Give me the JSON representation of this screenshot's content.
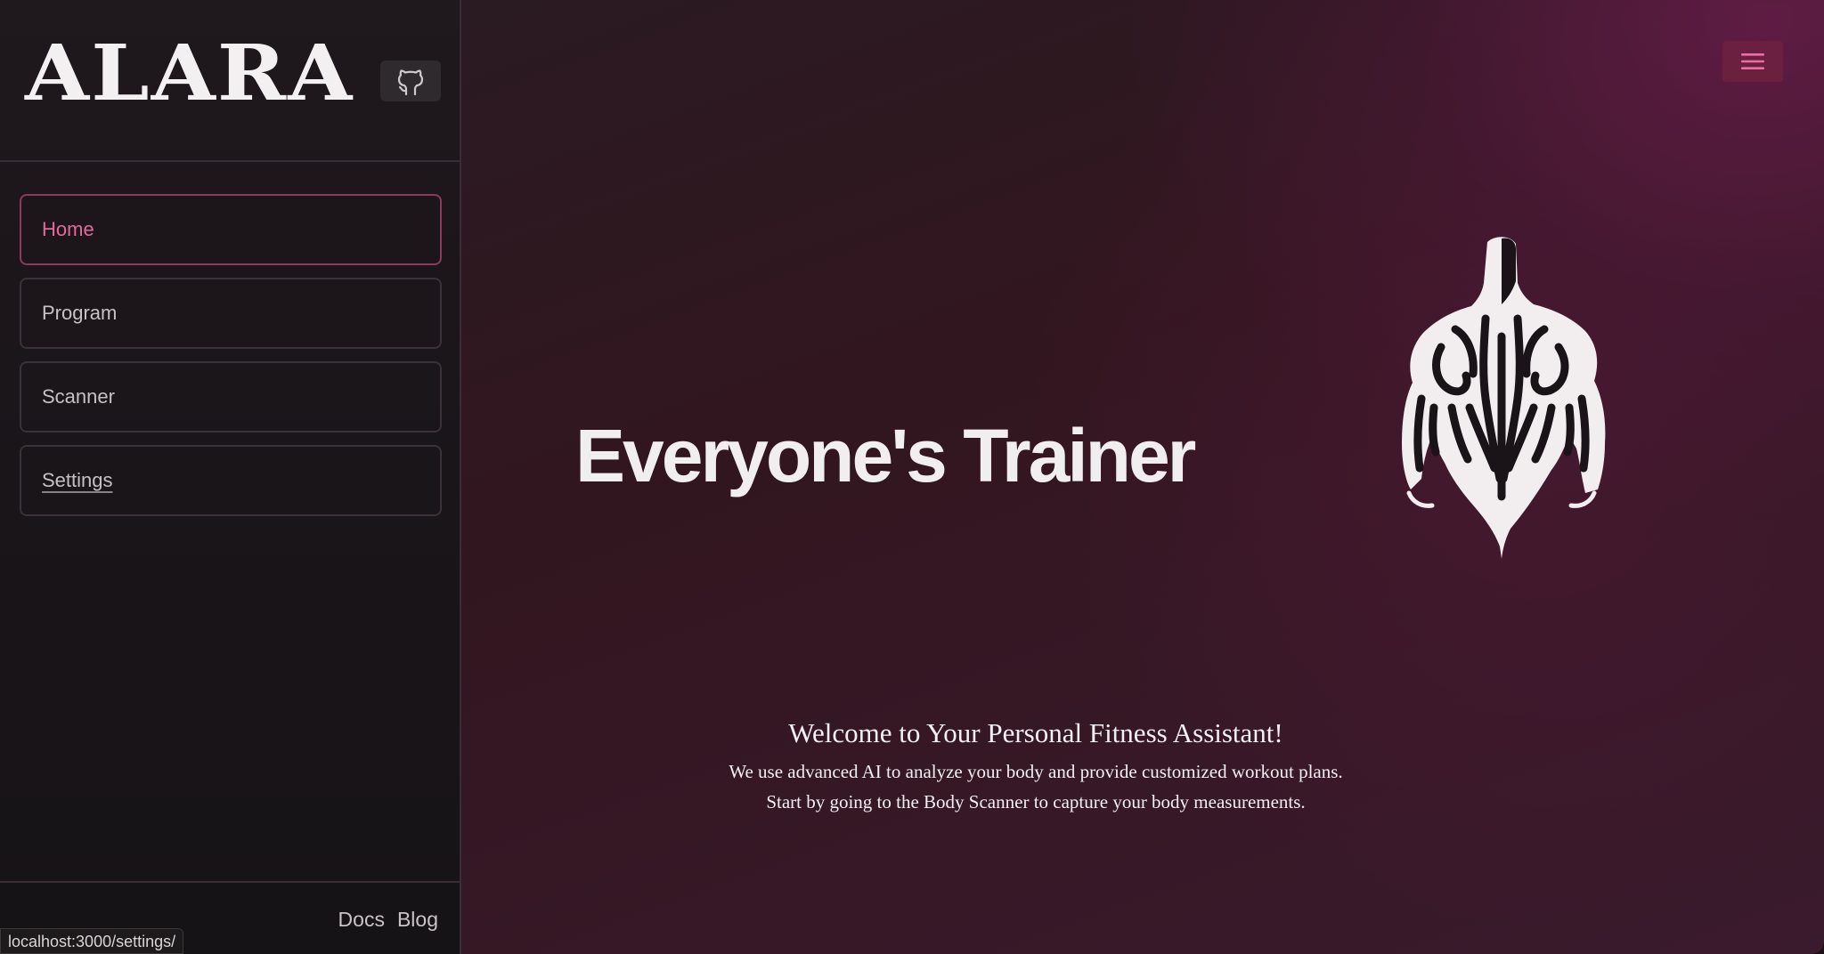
{
  "sidebar": {
    "logo": "ALARA",
    "github_icon": "github-icon",
    "nav": [
      {
        "label": "Home",
        "active": true
      },
      {
        "label": "Program",
        "active": false
      },
      {
        "label": "Scanner",
        "active": false
      },
      {
        "label": "Settings",
        "active": false
      }
    ],
    "footer_links": [
      "Docs",
      "Blog"
    ]
  },
  "status_bar": {
    "url": "localhost:3000/settings/"
  },
  "header": {
    "menu_icon": "hamburger-menu-icon"
  },
  "hero": {
    "title": "Everyone's Trainer",
    "figure_icon": "muscular-figure-icon"
  },
  "welcome": {
    "title": "Welcome to Your Personal Fitness Assistant!",
    "line1": "We use advanced AI to analyze your body and provide customized workout plans.",
    "line2": "Start by going to the Body Scanner to capture your body measurements."
  },
  "colors": {
    "accent": "#e06a9c",
    "menu_button": "#6b2040",
    "background": "#2a1a22"
  }
}
